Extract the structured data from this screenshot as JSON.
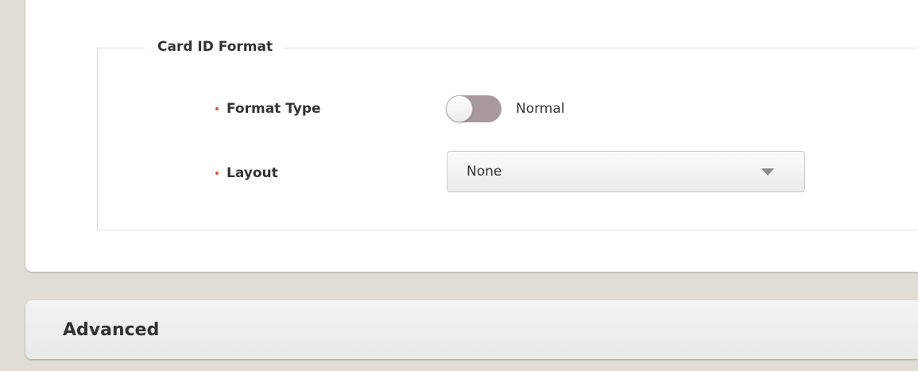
{
  "card_id_format": {
    "legend": "Card ID Format",
    "format_type": {
      "label": "Format Type",
      "toggle_state": "off",
      "value_text": "Normal"
    },
    "layout": {
      "label": "Layout",
      "selected": "None"
    }
  },
  "advanced": {
    "title": "Advanced"
  },
  "colors": {
    "background": "#e1dcd6",
    "required_marker": "#e0523a",
    "toggle_off": "#a89a9c",
    "text": "#333333"
  },
  "icons": {
    "select_arrow": "caret-down-icon"
  }
}
